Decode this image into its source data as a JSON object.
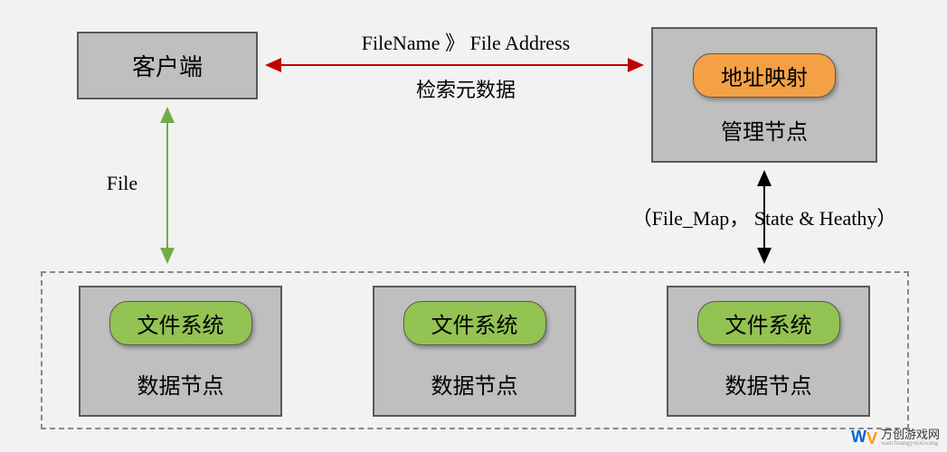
{
  "client": {
    "label": "客户端"
  },
  "manager": {
    "pill": "地址映射",
    "label": "管理节点"
  },
  "top_connection": {
    "line1_a": "FileName",
    "line1_sep": "》",
    "line1_b": "File Address",
    "line2": "检索元数据"
  },
  "left_connection": {
    "label": "File"
  },
  "right_connection": {
    "label": "（File_Map， State & Heathy）"
  },
  "data_nodes": {
    "pill": "文件系统",
    "label": "数据节点"
  },
  "watermark": {
    "cn": "万创游戏网",
    "en": "wanchuangyouxiwang"
  }
}
